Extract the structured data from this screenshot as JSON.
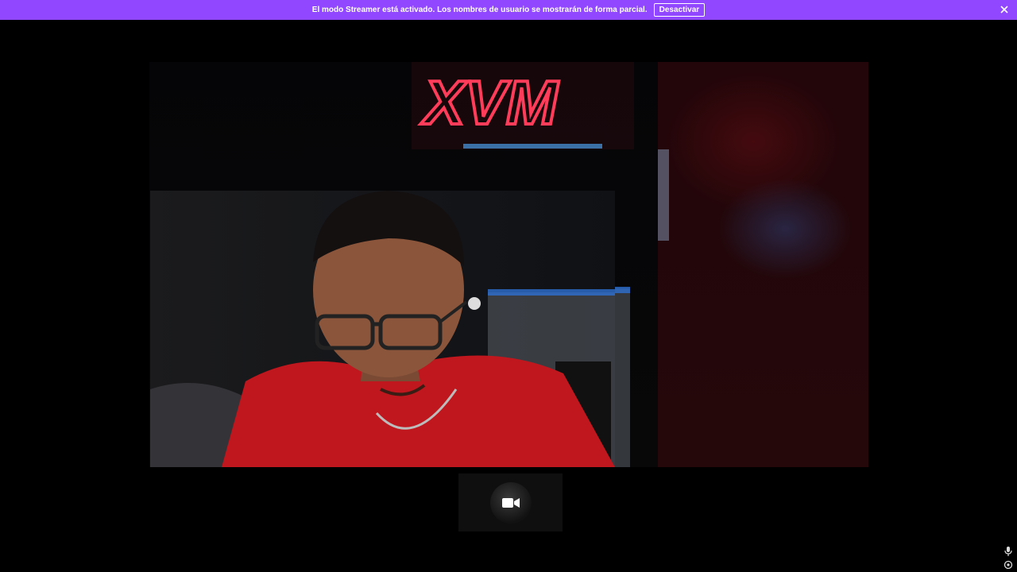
{
  "banner": {
    "message": "El modo Streamer está activado. Los nombres de usuario se mostrarán de forma parcial.",
    "deactivate_label": "Desactivar",
    "close_icon": "close-icon",
    "background_color": "#9147ff"
  },
  "video": {
    "neon_sign_text": "XVM"
  },
  "thumbnail": {
    "icon": "video-camera-icon"
  },
  "corner": {
    "icons": [
      "microphone-icon",
      "settings-icon"
    ]
  }
}
